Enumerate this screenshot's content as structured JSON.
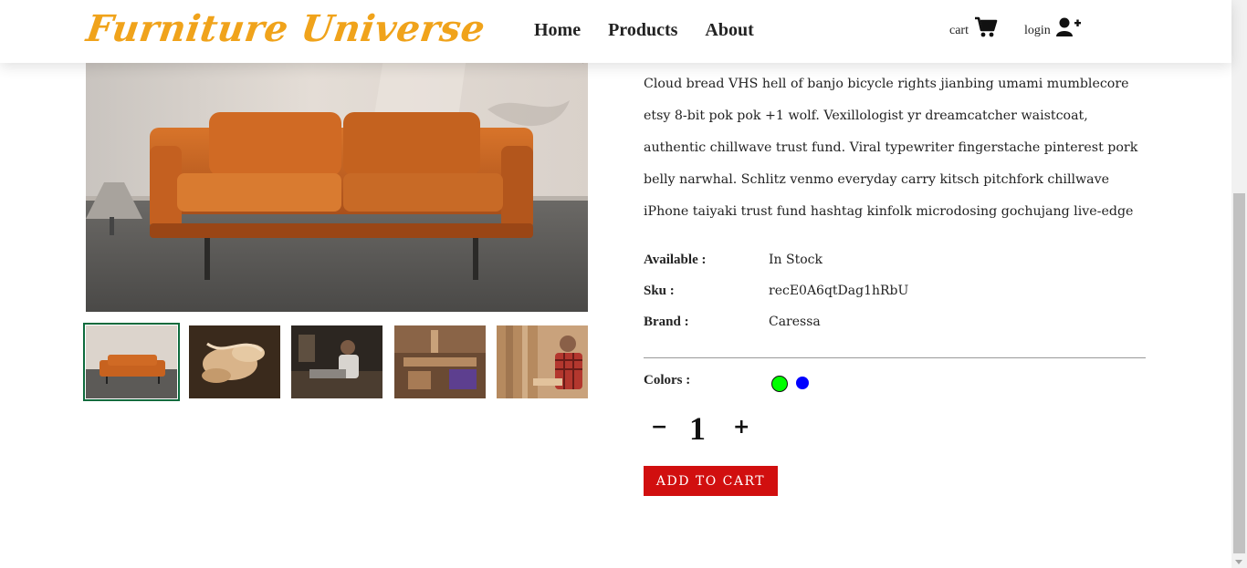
{
  "header": {
    "logo": "Furniture Universe",
    "nav": [
      "Home",
      "Products",
      "About"
    ],
    "cart_label": "cart",
    "login_label": "login"
  },
  "gallery": {
    "thumbnails": [
      "sofa",
      "wood-shavings",
      "craftsman-workshop",
      "workshop-interior",
      "woodworker"
    ]
  },
  "product": {
    "description": "Cloud bread VHS hell of banjo bicycle rights jianbing umami mumblecore etsy 8-bit pok pok +1 wolf. Vexillologist yr dreamcatcher waistcoat, authentic chillwave trust fund. Viral typewriter fingerstache pinterest pork belly narwhal. Schlitz venmo everyday carry kitsch pitchfork chillwave iPhone taiyaki trust fund hashtag kinfolk microdosing gochujang live-edge",
    "available_label": "Available :",
    "available_value": "In Stock",
    "sku_label": "Sku :",
    "sku_value": "recE0A6qtDag1hRbU",
    "brand_label": "Brand :",
    "brand_value": "Caressa",
    "colors_label": "Colors :",
    "colors": [
      "#00ff00",
      "#0000ff"
    ],
    "selected_color": "#00ff00",
    "quantity": "1",
    "minus_label": "−",
    "plus_label": "+",
    "add_to_cart": "ADD TO CART"
  },
  "theme": {
    "accent": "#f0a31b",
    "button": "#d10f0f",
    "thumb_outline": "#0e6b3d"
  }
}
